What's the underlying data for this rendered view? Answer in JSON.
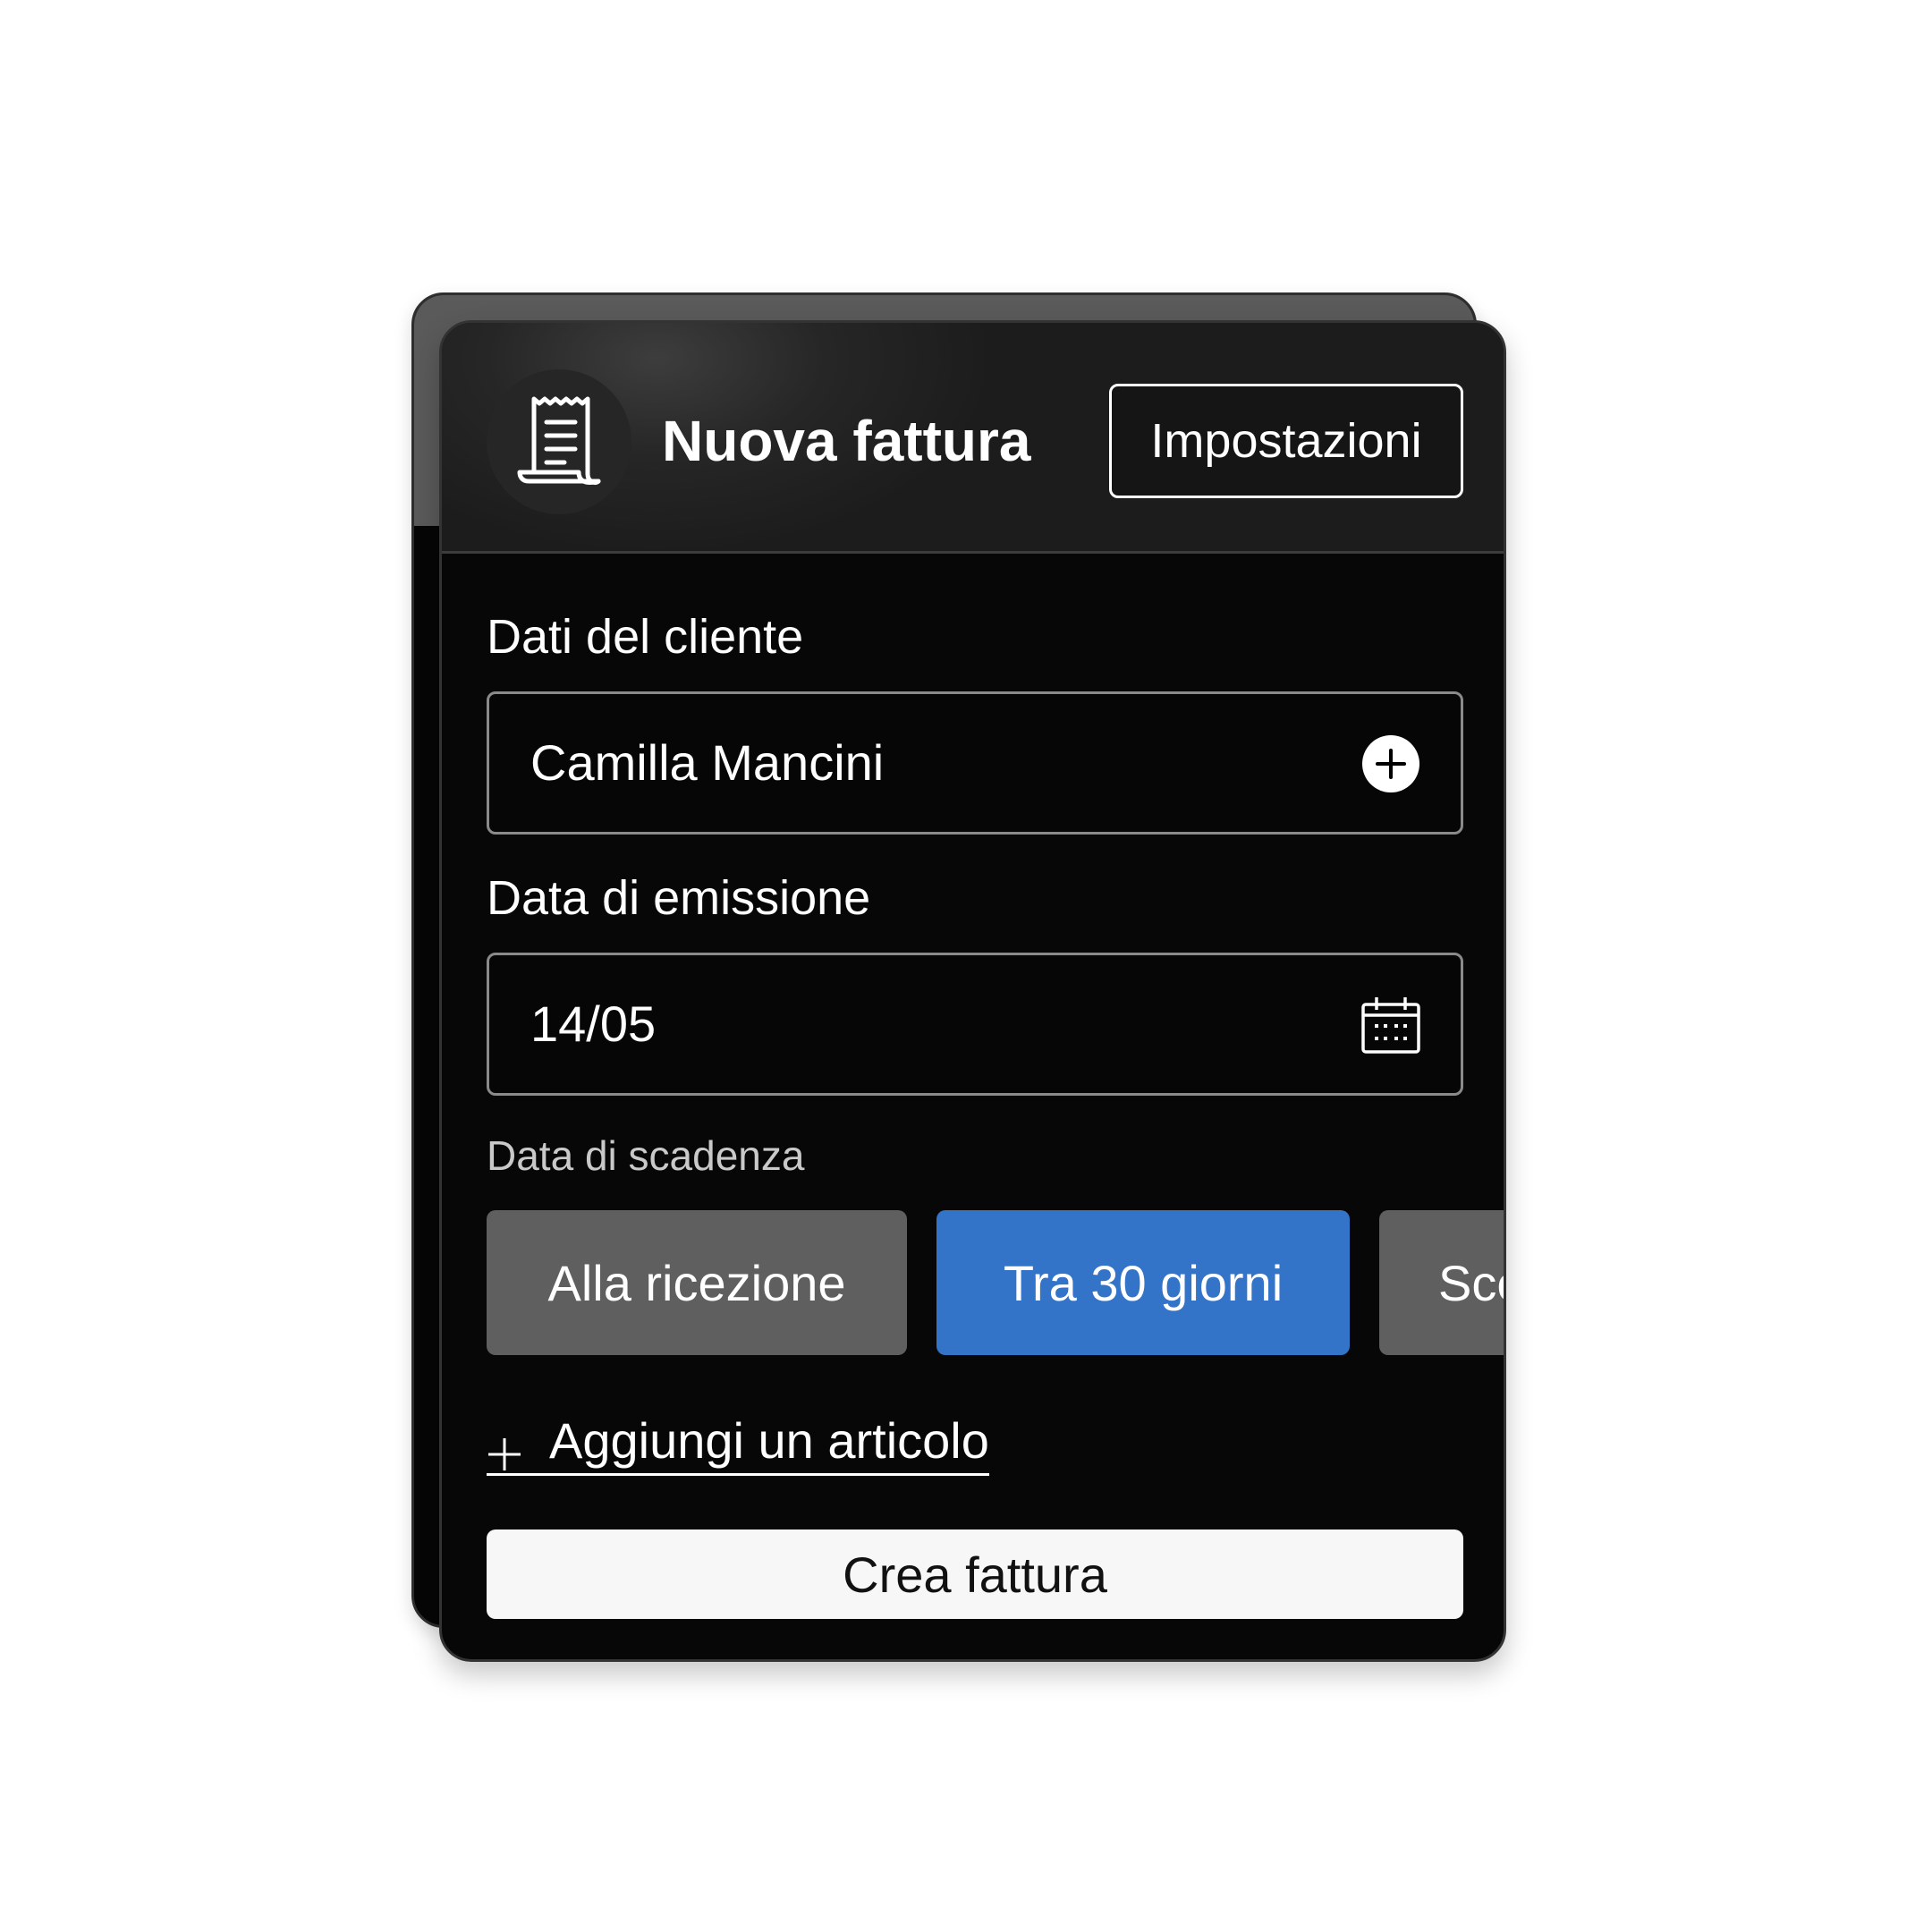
{
  "header": {
    "title": "Nuova fattura",
    "settings_label": "Impostazioni",
    "icon": "receipt-icon"
  },
  "client": {
    "label": "Dati del cliente",
    "value": "Camilla Mancini",
    "icon": "plus-circle-icon"
  },
  "issue_date": {
    "label": "Data di emissione",
    "value": "14/05",
    "icon": "calendar-icon"
  },
  "due_date": {
    "label": "Data di scadenza",
    "options": [
      {
        "label": "Alla ricezione",
        "selected": false
      },
      {
        "label": "Tra 30 giorni",
        "selected": true
      },
      {
        "label": "Sce",
        "selected": false
      }
    ]
  },
  "add_item": {
    "label": "Aggiungi un articolo",
    "icon": "plus-icon"
  },
  "create_label": "Crea fattura",
  "colors": {
    "card_bg": "#070707",
    "header_bg": "#262626",
    "chip_grey": "#5f5f5f",
    "chip_active": "#3374c8",
    "button_bg": "#f7f7f7"
  }
}
